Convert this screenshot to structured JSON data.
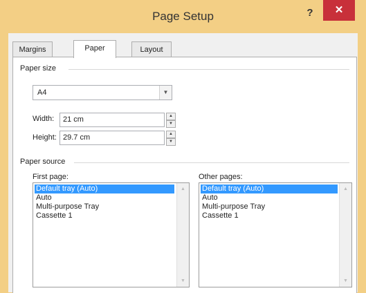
{
  "window": {
    "title": "Page Setup",
    "help": "?",
    "close": "✕"
  },
  "tabs": [
    {
      "label": "Margins"
    },
    {
      "label": "Paper"
    },
    {
      "label": "Layout"
    }
  ],
  "paper_size": {
    "group_label": "Paper size",
    "selected": "A4",
    "width_label": "Width:",
    "width_value": "21 cm",
    "height_label": "Height:",
    "height_value": "29.7 cm"
  },
  "paper_source": {
    "group_label": "Paper source",
    "first_page": {
      "label": "First page:",
      "items": [
        "Default tray (Auto)",
        "Auto",
        "Multi-purpose Tray",
        "Cassette 1"
      ],
      "selected_index": 0
    },
    "other_pages": {
      "label": "Other pages:",
      "items": [
        "Default tray (Auto)",
        "Auto",
        "Multi-purpose Tray",
        "Cassette 1"
      ],
      "selected_index": 0
    }
  },
  "colors": {
    "title_bar": "#f3cf85",
    "close": "#c8303a",
    "selection": "#3399ff"
  }
}
